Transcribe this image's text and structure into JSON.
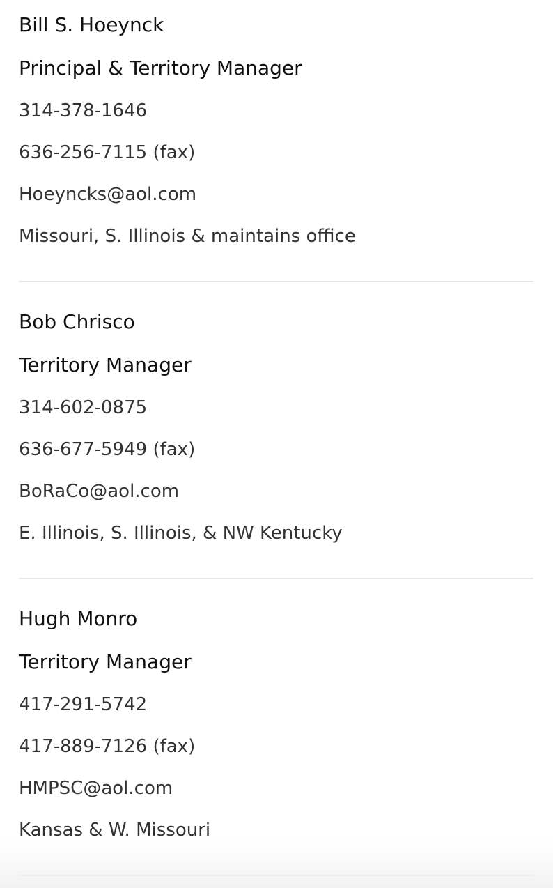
{
  "contacts": [
    {
      "name": "Bill S. Hoeynck",
      "title": "Principal & Territory Manager",
      "phone": "314-378-1646",
      "fax": "636-256-7115 (fax)",
      "email": "Hoeyncks@aol.com",
      "territory": "Missouri, S. Illinois & maintains office"
    },
    {
      "name": "Bob Chrisco",
      "title": "Territory Manager",
      "phone": "314-602-0875",
      "fax": "636-677-5949 (fax)",
      "email": "BoRaCo@aol.com",
      "territory": "E. Illinois, S. Illinois, & NW Kentucky"
    },
    {
      "name": "Hugh Monro",
      "title": "Territory Manager",
      "phone": "417-291-5742",
      "fax": "417-889-7126 (fax)",
      "email": "HMPSC@aol.com",
      "territory": "Kansas & W. Missouri"
    }
  ]
}
